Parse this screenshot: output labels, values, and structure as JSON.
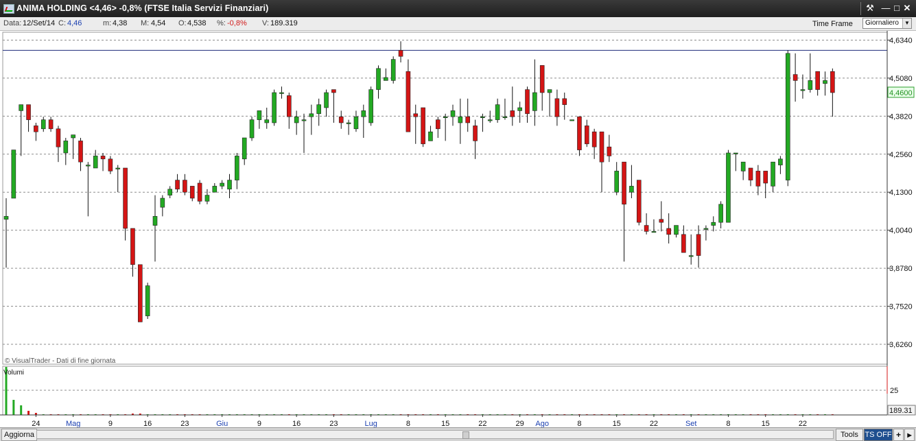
{
  "window": {
    "title": "ANIMA HOLDING <4,46> -0,8%  (FTSE Italia Servizi Finanziari)",
    "tools_icon": "wrench-icon",
    "minimize_icon": "minimize-icon",
    "maximize_icon": "maximize-icon",
    "close_icon": "close-icon"
  },
  "infobar": {
    "date_label": "Data:",
    "date_value": "12/Set/14",
    "close_label": "C:",
    "close_value": "4,46",
    "min_label": "m:",
    "min_value": "4,38",
    "max_label": "M:",
    "max_value": "4,54",
    "open_label": "O:",
    "open_value": "4,538",
    "pct_label": "%:",
    "pct_value": "-0,8%",
    "vol_label": "V:",
    "vol_value": "189.319",
    "timeframe_label": "Time Frame",
    "timeframe_value": "Giornaliero"
  },
  "chart_data": {
    "type": "candlestick",
    "ylim": [
      3.56,
      4.66
    ],
    "yticks": [
      "4,6340",
      "4,5080",
      "4,3820",
      "4,2560",
      "4,1300",
      "4,0040",
      "3,8780",
      "3,7520",
      "3,6260"
    ],
    "ytick_values": [
      4.634,
      4.508,
      4.382,
      4.256,
      4.13,
      4.004,
      3.878,
      3.752,
      3.626
    ],
    "last_price_label": "4,4600",
    "last_price": 4.46,
    "hline": 4.6,
    "credit": "© VisualTrader - Dati di fine giornata",
    "volume_label": "Volumi",
    "volume_tick": "25",
    "volume_last": "189.31",
    "xlabels": [
      {
        "t": "24",
        "i": 4
      },
      {
        "t": "Mag",
        "i": 9,
        "blue": true
      },
      {
        "t": "9",
        "i": 14
      },
      {
        "t": "16",
        "i": 19
      },
      {
        "t": "23",
        "i": 24
      },
      {
        "t": "Giu",
        "i": 29,
        "blue": true
      },
      {
        "t": "9",
        "i": 34
      },
      {
        "t": "16",
        "i": 39
      },
      {
        "t": "23",
        "i": 44
      },
      {
        "t": "Lug",
        "i": 49,
        "blue": true
      },
      {
        "t": "8",
        "i": 54
      },
      {
        "t": "15",
        "i": 59
      },
      {
        "t": "22",
        "i": 64
      },
      {
        "t": "29",
        "i": 69
      },
      {
        "t": "Ago",
        "i": 72,
        "blue": true
      },
      {
        "t": "8",
        "i": 77
      },
      {
        "t": "15",
        "i": 82
      },
      {
        "t": "22",
        "i": 87
      },
      {
        "t": "Set",
        "i": 92,
        "blue": true
      },
      {
        "t": "8",
        "i": 97
      },
      {
        "t": "15",
        "i": 102
      },
      {
        "t": "22",
        "i": 107
      }
    ],
    "candles": [
      [
        4.04,
        4.05,
        4.11,
        3.88
      ],
      [
        4.11,
        4.27,
        4.27,
        4.11
      ],
      [
        4.4,
        4.42,
        4.42,
        4.25
      ],
      [
        4.42,
        4.37,
        4.42,
        4.33
      ],
      [
        4.35,
        4.33,
        4.36,
        4.3
      ],
      [
        4.34,
        4.37,
        4.38,
        4.33
      ],
      [
        4.37,
        4.34,
        4.38,
        4.33
      ],
      [
        4.34,
        4.28,
        4.35,
        4.23
      ],
      [
        4.26,
        4.3,
        4.31,
        4.22
      ],
      [
        4.31,
        4.32,
        4.32,
        4.24
      ],
      [
        4.3,
        4.23,
        4.31,
        4.2
      ],
      [
        4.22,
        4.22,
        4.23,
        4.05
      ],
      [
        4.21,
        4.25,
        4.27,
        4.21
      ],
      [
        4.25,
        4.24,
        4.26,
        4.2
      ],
      [
        4.24,
        4.2,
        4.25,
        4.19
      ],
      [
        4.21,
        4.21,
        4.22,
        4.13
      ],
      [
        4.21,
        4.01,
        4.21,
        3.97
      ],
      [
        4.01,
        3.89,
        4.01,
        3.85
      ],
      [
        3.89,
        3.7,
        3.89,
        3.7
      ],
      [
        3.72,
        3.82,
        3.83,
        3.71
      ],
      [
        4.02,
        4.05,
        4.12,
        3.9
      ],
      [
        4.08,
        4.11,
        4.12,
        4.05
      ],
      [
        4.12,
        4.14,
        4.15,
        4.11
      ],
      [
        4.17,
        4.14,
        4.19,
        4.13
      ],
      [
        4.17,
        4.13,
        4.19,
        4.12
      ],
      [
        4.15,
        4.11,
        4.15,
        4.1
      ],
      [
        4.16,
        4.1,
        4.17,
        4.09
      ],
      [
        4.1,
        4.12,
        4.14,
        4.09
      ],
      [
        4.13,
        4.15,
        4.16,
        4.13
      ],
      [
        4.15,
        4.16,
        4.17,
        4.14
      ],
      [
        4.14,
        4.17,
        4.19,
        4.11
      ],
      [
        4.17,
        4.25,
        4.26,
        4.14
      ],
      [
        4.24,
        4.31,
        4.31,
        4.22
      ],
      [
        4.31,
        4.37,
        4.38,
        4.3
      ],
      [
        4.37,
        4.4,
        4.4,
        4.34
      ],
      [
        4.36,
        4.37,
        4.41,
        4.34
      ],
      [
        4.36,
        4.46,
        4.47,
        4.35
      ],
      [
        4.46,
        4.46,
        4.48,
        4.44
      ],
      [
        4.45,
        4.38,
        4.46,
        4.34
      ],
      [
        4.36,
        4.38,
        4.4,
        4.32
      ],
      [
        4.37,
        4.37,
        4.39,
        4.26
      ],
      [
        4.38,
        4.39,
        4.42,
        4.32
      ],
      [
        4.39,
        4.42,
        4.44,
        4.35
      ],
      [
        4.41,
        4.46,
        4.47,
        4.38
      ],
      [
        4.47,
        4.46,
        4.47,
        4.36
      ],
      [
        4.38,
        4.36,
        4.4,
        4.34
      ],
      [
        4.36,
        4.36,
        4.37,
        4.32
      ],
      [
        4.34,
        4.38,
        4.4,
        4.33
      ],
      [
        4.38,
        4.4,
        4.42,
        4.31
      ],
      [
        4.36,
        4.47,
        4.48,
        4.35
      ],
      [
        4.47,
        4.54,
        4.55,
        4.44
      ],
      [
        4.5,
        4.51,
        4.54,
        4.5
      ],
      [
        4.5,
        4.57,
        4.58,
        4.49
      ],
      [
        4.6,
        4.58,
        4.63,
        4.56
      ],
      [
        4.53,
        4.33,
        4.57,
        4.33
      ],
      [
        4.39,
        4.38,
        4.42,
        4.29
      ],
      [
        4.41,
        4.29,
        4.41,
        4.28
      ],
      [
        4.3,
        4.33,
        4.35,
        4.31
      ],
      [
        4.37,
        4.34,
        4.38,
        4.31
      ],
      [
        4.38,
        4.38,
        4.39,
        4.3
      ],
      [
        4.38,
        4.4,
        4.42,
        4.35
      ],
      [
        4.36,
        4.38,
        4.44,
        4.29
      ],
      [
        4.38,
        4.36,
        4.44,
        4.33
      ],
      [
        4.35,
        4.3,
        4.37,
        4.24
      ],
      [
        4.38,
        4.38,
        4.39,
        4.33
      ],
      [
        4.37,
        4.37,
        4.4,
        4.36
      ],
      [
        4.37,
        4.42,
        4.44,
        4.36
      ],
      [
        4.38,
        4.38,
        4.44,
        4.37
      ],
      [
        4.4,
        4.38,
        4.48,
        4.35
      ],
      [
        4.4,
        4.41,
        4.43,
        4.36
      ],
      [
        4.47,
        4.39,
        4.48,
        4.36
      ],
      [
        4.4,
        4.46,
        4.57,
        4.35
      ],
      [
        4.55,
        4.46,
        4.55,
        4.4
      ],
      [
        4.46,
        4.47,
        4.47,
        4.38
      ],
      [
        4.44,
        4.38,
        4.47,
        4.35
      ],
      [
        4.44,
        4.42,
        4.46,
        4.37
      ],
      [
        4.37,
        4.37,
        4.37,
        4.37
      ],
      [
        4.38,
        4.27,
        4.38,
        4.25
      ],
      [
        4.35,
        4.29,
        4.37,
        4.28
      ],
      [
        4.33,
        4.28,
        4.34,
        4.24
      ],
      [
        4.33,
        4.23,
        4.33,
        4.13
      ],
      [
        4.28,
        4.25,
        4.32,
        4.23
      ],
      [
        4.13,
        4.2,
        4.23,
        4.12
      ],
      [
        4.23,
        4.09,
        4.23,
        3.9
      ],
      [
        4.13,
        4.15,
        4.22,
        4.11
      ],
      [
        4.17,
        4.03,
        4.17,
        4.02
      ],
      [
        4.02,
        4.0,
        4.06,
        3.99
      ],
      [
        4.0,
        4.0,
        4.04,
        4.0
      ],
      [
        4.04,
        4.03,
        4.1,
        4.0
      ],
      [
        4.01,
        3.99,
        4.06,
        3.96
      ],
      [
        3.99,
        4.02,
        4.02,
        3.98
      ],
      [
        3.99,
        3.93,
        4.02,
        3.93
      ],
      [
        3.92,
        3.92,
        3.99,
        3.89
      ],
      [
        3.99,
        3.92,
        4.02,
        3.88
      ],
      [
        4.01,
        4.01,
        4.02,
        3.97
      ],
      [
        4.02,
        4.03,
        4.05,
        4.0
      ],
      [
        4.03,
        4.09,
        4.1,
        4.01
      ],
      [
        4.03,
        4.26,
        4.27,
        4.03
      ],
      [
        4.26,
        4.26,
        4.26,
        4.2
      ],
      [
        4.2,
        4.23,
        4.23,
        4.17
      ],
      [
        4.21,
        4.17,
        4.21,
        4.15
      ],
      [
        4.2,
        4.15,
        4.22,
        4.12
      ],
      [
        4.2,
        4.16,
        4.2,
        4.11
      ],
      [
        4.15,
        4.23,
        4.23,
        4.13
      ],
      [
        4.22,
        4.24,
        4.25,
        4.19
      ],
      [
        4.17,
        4.59,
        4.6,
        4.15
      ],
      [
        4.52,
        4.5,
        4.59,
        4.43
      ],
      [
        4.47,
        4.47,
        4.52,
        4.44
      ],
      [
        4.47,
        4.5,
        4.59,
        4.46
      ],
      [
        4.53,
        4.47,
        4.53,
        4.45
      ],
      [
        4.49,
        4.5,
        4.53,
        4.45
      ],
      [
        4.53,
        4.46,
        4.54,
        4.38
      ]
    ],
    "volumes": [
      70,
      22,
      14,
      6,
      3,
      1,
      1,
      1,
      1,
      1,
      1,
      1,
      1,
      1,
      1,
      1,
      1,
      2,
      2,
      1,
      1,
      1,
      1,
      1,
      1,
      1,
      1,
      1,
      1,
      1,
      1,
      1,
      1,
      1,
      1,
      1,
      1,
      1,
      1,
      1,
      1,
      1,
      1,
      1,
      1,
      1,
      1,
      1,
      1,
      1,
      1,
      1,
      1,
      1,
      1,
      1,
      1,
      1,
      1,
      1,
      1,
      1,
      1,
      1,
      1,
      1,
      1,
      1,
      1,
      1,
      1,
      1,
      1,
      1,
      1,
      1,
      1,
      1,
      1,
      1,
      1,
      1,
      1,
      1,
      1,
      1,
      1,
      1,
      1,
      1,
      1,
      1,
      1,
      1,
      1,
      1,
      1,
      1,
      1,
      1,
      1,
      1,
      1,
      1,
      1,
      1,
      1,
      1,
      1,
      1,
      1,
      1
    ]
  },
  "bottombar": {
    "refresh_label": "Aggiorna",
    "tools_label": "Tools",
    "tsoff_label": "TS OFF",
    "plus_label": "+",
    "more_label": "▸"
  }
}
